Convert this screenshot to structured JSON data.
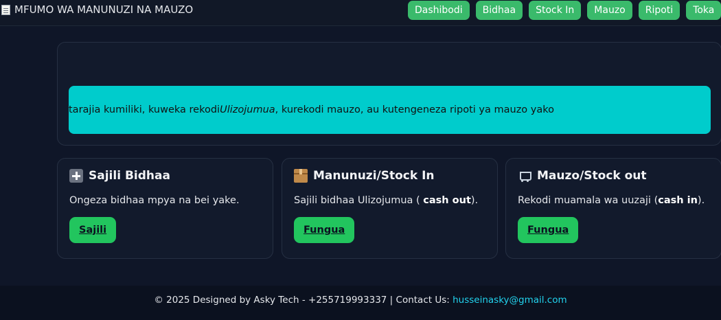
{
  "navbar": {
    "brand_icon": "receipt-icon",
    "brand": "MFUMO WA MANUNUZI NA MAUZO",
    "links": [
      "Dashibodi",
      "Bidhaa",
      "Stock In",
      "Mauzo",
      "Ripoti",
      "Toka"
    ],
    "button_color": "#3aba6b"
  },
  "hero": {
    "banner_prefix": "tarajia kumiliki, kuweka rekodi ",
    "banner_emphasis": "Ulizojumua",
    "banner_suffix": ", kurekodi mauzo, au kutengeneza ripoti ya mauzo yako",
    "banner_color": "#00cccc"
  },
  "cards": [
    {
      "icon": "plus-icon",
      "title": "Sajili Bidhaa",
      "text_prefix": "Ongeza bidhaa mpya na bei yake.",
      "text_bold": "",
      "text_suffix": "",
      "button": "Sajili"
    },
    {
      "icon": "package-icon",
      "title": "Manunuzi/Stock In",
      "text_prefix": "Sajili bidhaa Ulizojumua ( ",
      "text_bold": "cash out",
      "text_suffix": ").",
      "button": "Fungua"
    },
    {
      "icon": "shopping-cart-icon",
      "title": "Mauzo/Stock out",
      "text_prefix": "Rekodi muamala wa uuzaji (",
      "text_bold": "cash in",
      "text_suffix": ").",
      "button": "Fungua"
    }
  ],
  "footer": {
    "text": "© 2025 Designed by Asky Tech - +255719993337 | Contact Us: ",
    "email": "husseinasky@gmail.com",
    "link_color": "#22d3ee"
  }
}
